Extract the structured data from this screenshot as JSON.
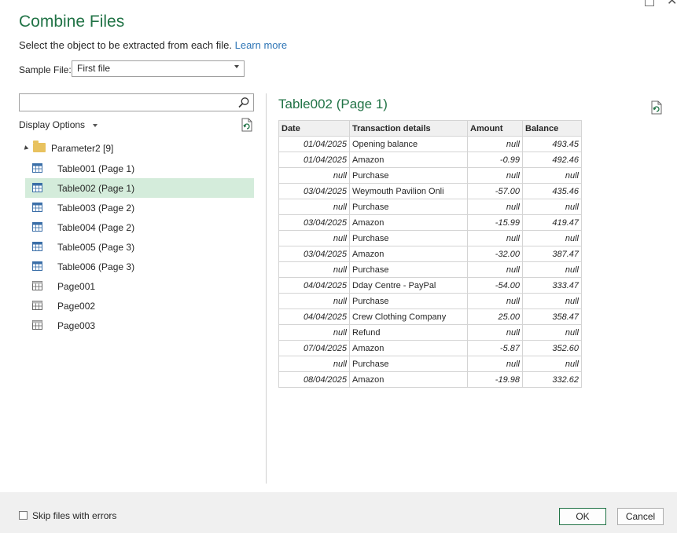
{
  "dialog": {
    "title": "Combine Files",
    "instruction": "Select the object to be extracted from each file.",
    "learn_more": "Learn more",
    "sample_file_label": "Sample File:",
    "sample_file_value": "First file",
    "search": {
      "value": "",
      "placeholder": ""
    },
    "display_options_label": "Display Options",
    "icons": {
      "search": "magnifier-icon",
      "refresh": "refresh-icon",
      "folder": "folder-icon",
      "table": "table-icon",
      "page": "page-icon"
    },
    "accent_color": "#217346"
  },
  "tree": {
    "root_label": "Parameter2 [9]",
    "items": [
      {
        "label": "Table001 (Page 1)",
        "kind": "table",
        "selected": false
      },
      {
        "label": "Table002 (Page 1)",
        "kind": "table",
        "selected": true
      },
      {
        "label": "Table003 (Page 2)",
        "kind": "table",
        "selected": false
      },
      {
        "label": "Table004 (Page 2)",
        "kind": "table",
        "selected": false
      },
      {
        "label": "Table005 (Page 3)",
        "kind": "table",
        "selected": false
      },
      {
        "label": "Table006 (Page 3)",
        "kind": "table",
        "selected": false
      },
      {
        "label": "Page001",
        "kind": "page",
        "selected": false
      },
      {
        "label": "Page002",
        "kind": "page",
        "selected": false
      },
      {
        "label": "Page003",
        "kind": "page",
        "selected": false
      }
    ]
  },
  "preview": {
    "title": "Table002 (Page 1)",
    "columns": [
      "Date",
      "Transaction details",
      "Amount",
      "Balance"
    ],
    "rows": [
      [
        "01/04/2025",
        "Opening balance",
        "null",
        "493.45"
      ],
      [
        "01/04/2025",
        "Amazon",
        "-0.99",
        "492.46"
      ],
      [
        "null",
        "Purchase",
        "null",
        "null"
      ],
      [
        "03/04/2025",
        "Weymouth Pavilion Onli",
        "-57.00",
        "435.46"
      ],
      [
        "null",
        "Purchase",
        "null",
        "null"
      ],
      [
        "03/04/2025",
        "Amazon",
        "-15.99",
        "419.47"
      ],
      [
        "null",
        "Purchase",
        "null",
        "null"
      ],
      [
        "03/04/2025",
        "Amazon",
        "-32.00",
        "387.47"
      ],
      [
        "null",
        "Purchase",
        "null",
        "null"
      ],
      [
        "04/04/2025",
        "Dday Centre - PayPal",
        "-54.00",
        "333.47"
      ],
      [
        "null",
        "Purchase",
        "null",
        "null"
      ],
      [
        "04/04/2025",
        "Crew Clothing Company",
        "25.00",
        "358.47"
      ],
      [
        "null",
        "Refund",
        "null",
        "null"
      ],
      [
        "07/04/2025",
        "Amazon",
        "-5.87",
        "352.60"
      ],
      [
        "null",
        "Purchase",
        "null",
        "null"
      ],
      [
        "08/04/2025",
        "Amazon",
        "-19.98",
        "332.62"
      ]
    ]
  },
  "footer": {
    "skip_errors_label": "Skip files with errors",
    "skip_errors_checked": false,
    "ok_label": "OK",
    "cancel_label": "Cancel"
  }
}
